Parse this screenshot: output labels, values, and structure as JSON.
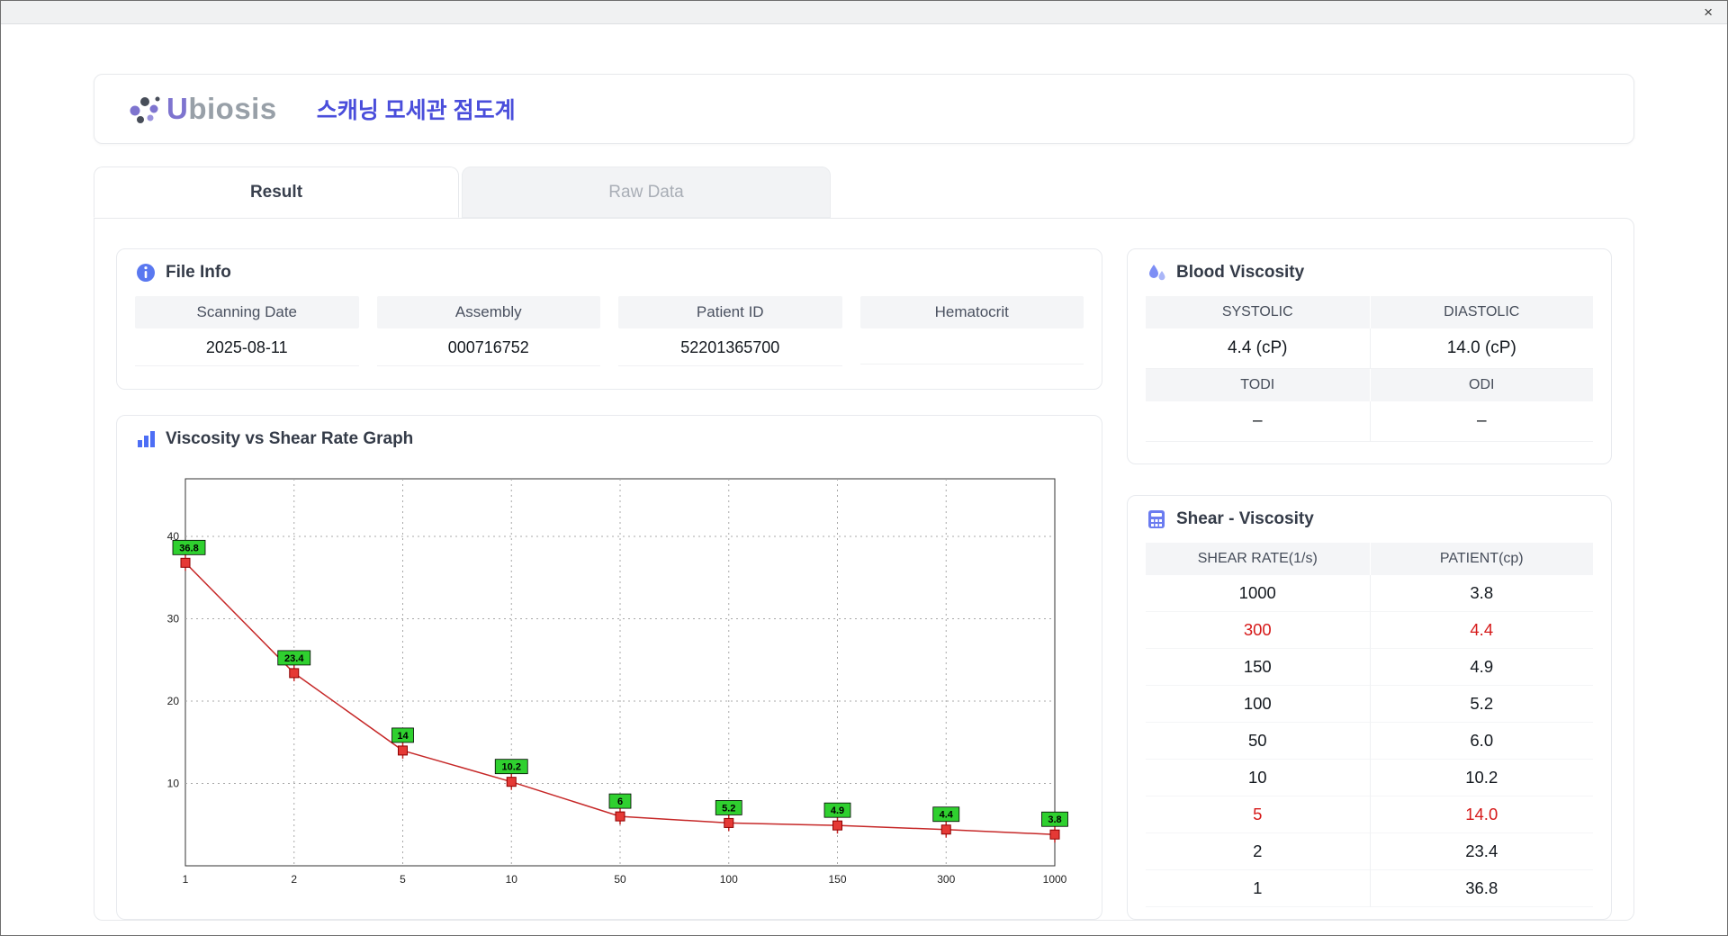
{
  "window": {
    "close_label": "×"
  },
  "header": {
    "logo_text_cap": "U",
    "logo_text_rest": "biosis",
    "title": "스캐닝 모세관 점도계"
  },
  "tabs": [
    {
      "label": "Result",
      "active": true
    },
    {
      "label": "Raw Data",
      "active": false
    }
  ],
  "file_info": {
    "title": "File Info",
    "fields": [
      {
        "label": "Scanning Date",
        "value": "2025-08-11"
      },
      {
        "label": "Assembly",
        "value": "000716752"
      },
      {
        "label": "Patient ID",
        "value": "52201365700"
      },
      {
        "label": "Hematocrit",
        "value": ""
      }
    ]
  },
  "graph": {
    "title": "Viscosity vs Shear Rate Graph"
  },
  "blood_viscosity": {
    "title": "Blood Viscosity",
    "rows": [
      {
        "labels": [
          "SYSTOLIC",
          "DIASTOLIC"
        ],
        "values": [
          "4.4 (cP)",
          "14.0 (cP)"
        ]
      },
      {
        "labels": [
          "TODI",
          "ODI"
        ],
        "values": [
          "–",
          "–"
        ]
      }
    ]
  },
  "shear_table": {
    "title": "Shear - Viscosity",
    "columns": [
      "SHEAR RATE(1/s)",
      "PATIENT(cp)"
    ],
    "rows": [
      {
        "shear": "1000",
        "patient": "3.8",
        "highlight": false
      },
      {
        "shear": "300",
        "patient": "4.4",
        "highlight": true
      },
      {
        "shear": "150",
        "patient": "4.9",
        "highlight": false
      },
      {
        "shear": "100",
        "patient": "5.2",
        "highlight": false
      },
      {
        "shear": "50",
        "patient": "6.0",
        "highlight": false
      },
      {
        "shear": "10",
        "patient": "10.2",
        "highlight": false
      },
      {
        "shear": "5",
        "patient": "14.0",
        "highlight": true
      },
      {
        "shear": "2",
        "patient": "23.4",
        "highlight": false
      },
      {
        "shear": "1",
        "patient": "36.8",
        "highlight": false
      }
    ]
  },
  "chart_data": {
    "type": "line",
    "title": "Viscosity vs Shear Rate Graph",
    "xlabel": "",
    "ylabel": "",
    "categories": [
      "1",
      "2",
      "5",
      "10",
      "50",
      "100",
      "150",
      "300",
      "1000"
    ],
    "values": [
      36.8,
      23.4,
      14,
      10.2,
      6,
      5.2,
      4.9,
      4.4,
      3.8
    ],
    "labels": [
      "36.8",
      "23.4",
      "14",
      "10.2",
      "6",
      "5.2",
      "4.9",
      "4.4",
      "3.8"
    ],
    "yticks": [
      10,
      20,
      30,
      40
    ],
    "ylim": [
      0,
      47
    ],
    "grid": "dashed",
    "line_color": "#c62828",
    "marker_color": "#e53935",
    "label_bg": "#2fd02f",
    "legend": "none"
  }
}
